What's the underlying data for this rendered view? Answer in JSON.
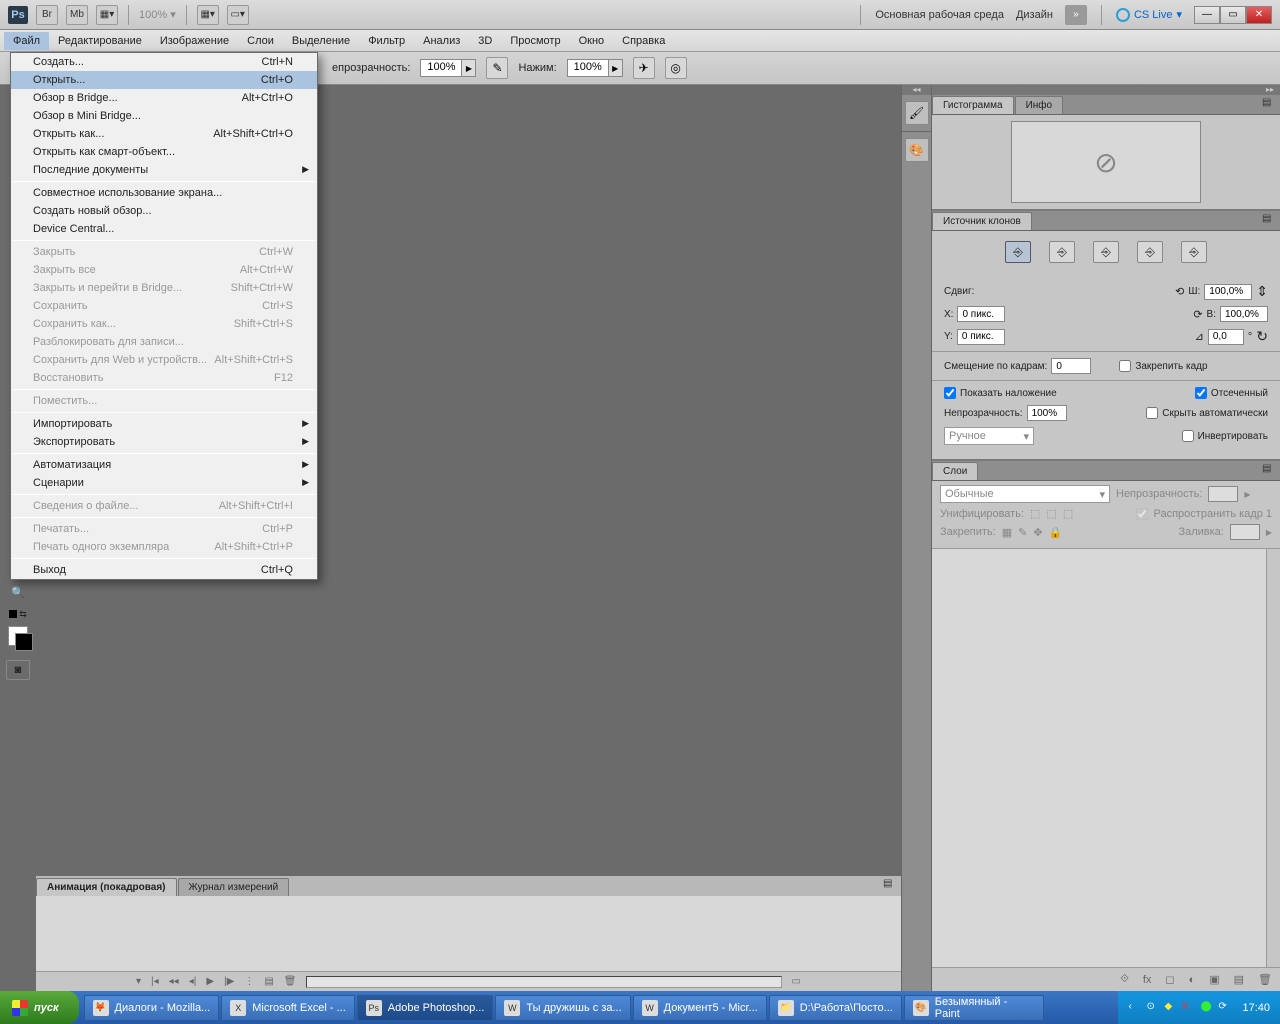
{
  "app_bar": {
    "ps": "Ps",
    "br": "Br",
    "mb": "Mb",
    "zoom": "100%",
    "workspace": "Основная рабочая среда",
    "design": "Дизайн",
    "cslive": "CS Live"
  },
  "menu": {
    "file": "Файл",
    "edit": "Редактирование",
    "image": "Изображение",
    "layer": "Слои",
    "select": "Выделение",
    "filter": "Фильтр",
    "analysis": "Анализ",
    "threed": "3D",
    "view": "Просмотр",
    "window": "Окно",
    "help": "Справка"
  },
  "options_bar": {
    "opacity_label": "епрозрачность:",
    "opacity_val": "100%",
    "flow_label": "Нажим:",
    "flow_val": "100%"
  },
  "file_menu": [
    {
      "label": "Создать...",
      "shortcut": "Ctrl+N",
      "hl": false,
      "dis": false,
      "sub": false
    },
    {
      "label": "Открыть...",
      "shortcut": "Ctrl+O",
      "hl": true,
      "dis": false,
      "sub": false
    },
    {
      "label": "Обзор в Bridge...",
      "shortcut": "Alt+Ctrl+O",
      "hl": false,
      "dis": false,
      "sub": false
    },
    {
      "label": "Обзор в Mini Bridge...",
      "shortcut": "",
      "hl": false,
      "dis": false,
      "sub": false
    },
    {
      "label": "Открыть как...",
      "shortcut": "Alt+Shift+Ctrl+O",
      "hl": false,
      "dis": false,
      "sub": false
    },
    {
      "label": "Открыть как смарт-объект...",
      "shortcut": "",
      "hl": false,
      "dis": false,
      "sub": false
    },
    {
      "label": "Последние документы",
      "shortcut": "",
      "hl": false,
      "dis": false,
      "sub": true
    },
    {
      "sep": true
    },
    {
      "label": "Совместное использование экрана...",
      "shortcut": "",
      "hl": false,
      "dis": false,
      "sub": false
    },
    {
      "label": "Создать новый обзор...",
      "shortcut": "",
      "hl": false,
      "dis": false,
      "sub": false
    },
    {
      "label": "Device Central...",
      "shortcut": "",
      "hl": false,
      "dis": false,
      "sub": false
    },
    {
      "sep": true
    },
    {
      "label": "Закрыть",
      "shortcut": "Ctrl+W",
      "hl": false,
      "dis": true,
      "sub": false
    },
    {
      "label": "Закрыть все",
      "shortcut": "Alt+Ctrl+W",
      "hl": false,
      "dis": true,
      "sub": false
    },
    {
      "label": "Закрыть и перейти в Bridge...",
      "shortcut": "Shift+Ctrl+W",
      "hl": false,
      "dis": true,
      "sub": false
    },
    {
      "label": "Сохранить",
      "shortcut": "Ctrl+S",
      "hl": false,
      "dis": true,
      "sub": false
    },
    {
      "label": "Сохранить как...",
      "shortcut": "Shift+Ctrl+S",
      "hl": false,
      "dis": true,
      "sub": false
    },
    {
      "label": "Разблокировать для записи...",
      "shortcut": "",
      "hl": false,
      "dis": true,
      "sub": false
    },
    {
      "label": "Сохранить для Web и устройств...",
      "shortcut": "Alt+Shift+Ctrl+S",
      "hl": false,
      "dis": true,
      "sub": false
    },
    {
      "label": "Восстановить",
      "shortcut": "F12",
      "hl": false,
      "dis": true,
      "sub": false
    },
    {
      "sep": true
    },
    {
      "label": "Поместить...",
      "shortcut": "",
      "hl": false,
      "dis": true,
      "sub": false
    },
    {
      "sep": true
    },
    {
      "label": "Импортировать",
      "shortcut": "",
      "hl": false,
      "dis": false,
      "sub": true
    },
    {
      "label": "Экспортировать",
      "shortcut": "",
      "hl": false,
      "dis": false,
      "sub": true
    },
    {
      "sep": true
    },
    {
      "label": "Автоматизация",
      "shortcut": "",
      "hl": false,
      "dis": false,
      "sub": true
    },
    {
      "label": "Сценарии",
      "shortcut": "",
      "hl": false,
      "dis": false,
      "sub": true
    },
    {
      "sep": true
    },
    {
      "label": "Сведения о файле...",
      "shortcut": "Alt+Shift+Ctrl+I",
      "hl": false,
      "dis": true,
      "sub": false
    },
    {
      "sep": true
    },
    {
      "label": "Печатать...",
      "shortcut": "Ctrl+P",
      "hl": false,
      "dis": true,
      "sub": false
    },
    {
      "label": "Печать одного экземпляра",
      "shortcut": "Alt+Shift+Ctrl+P",
      "hl": false,
      "dis": true,
      "sub": false
    },
    {
      "sep": true
    },
    {
      "label": "Выход",
      "shortcut": "Ctrl+Q",
      "hl": false,
      "dis": false,
      "sub": false
    }
  ],
  "panels": {
    "histogram_tab": "Гистограмма",
    "info_tab": "Инфо",
    "clone_src_tab": "Источник клонов",
    "layers_tab": "Слои",
    "shift_label": "Сдвиг:",
    "x_label": "X:",
    "y_label": "Y:",
    "x_val": "0 пикс.",
    "y_val": "0 пикс.",
    "w_label": "Ш:",
    "h_label": "В:",
    "w_val": "100,0%",
    "h_val": "100,0%",
    "angle_val": "0,0",
    "deg": "°",
    "frame_offset": "Смещение по кадрам:",
    "frame_offset_val": "0",
    "lock_frame": "Закрепить кадр",
    "show_overlay": "Показать наложение",
    "clipped": "Отсеченный",
    "overlay_opacity_label": "Непрозрачность:",
    "overlay_opacity_val": "100%",
    "auto_hide": "Скрыть автоматически",
    "overlay_mode": "Ручное",
    "invert": "Инвертировать",
    "blend_mode": "Обычные",
    "opacity_label": "Непрозрачность:",
    "unify_label": "Унифицировать:",
    "propagate": "Распространить кадр 1",
    "lock_label": "Закрепить:",
    "fill_label": "Заливка:"
  },
  "animation": {
    "tab1": "Анимация (покадровая)",
    "tab2": "Журнал измерений"
  },
  "taskbar": {
    "start": "пуск",
    "items": [
      {
        "label": "Диалоги - Mozilla...",
        "icon": "🦊"
      },
      {
        "label": "Microsoft Excel - ...",
        "icon": "X"
      },
      {
        "label": "Adobe Photoshop...",
        "icon": "Ps",
        "active": true
      },
      {
        "label": "Ты дружишь с за...",
        "icon": "W"
      },
      {
        "label": "Документ5 - Micr...",
        "icon": "W"
      },
      {
        "label": "D:\\Работа\\Посто...",
        "icon": "📁"
      },
      {
        "label": "Безымянный - Paint",
        "icon": "🎨"
      }
    ],
    "clock": "17:40"
  }
}
